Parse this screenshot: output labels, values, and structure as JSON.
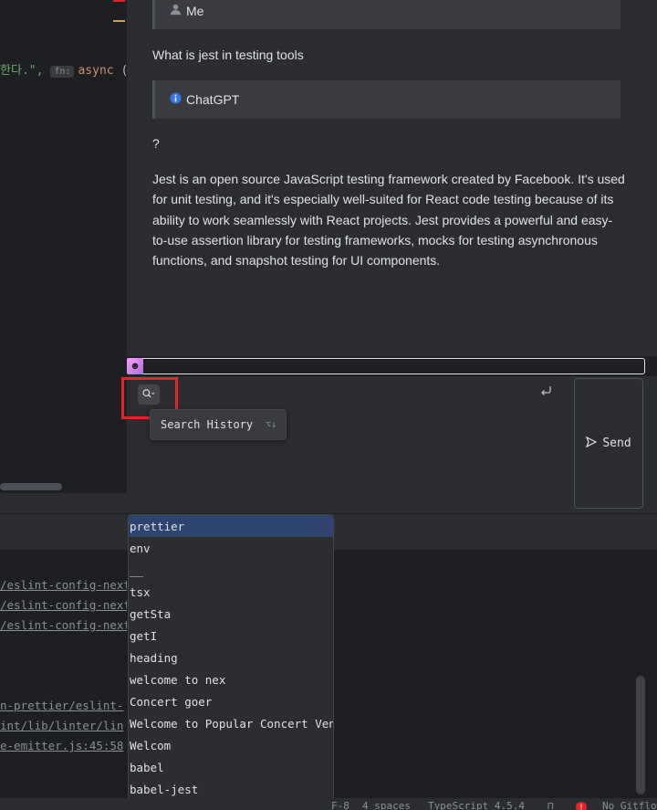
{
  "editor": {
    "code_string": "한다.\",",
    "fn_tag": "fn:",
    "keyword": "async",
    "paren": "("
  },
  "chat": {
    "messages": [
      {
        "role_icon": "person-icon",
        "role_label": "Me"
      },
      {
        "text": "What is jest in testing tools"
      },
      {
        "role_icon": "info-icon",
        "role_label": "ChatGPT"
      },
      {
        "text": "?"
      },
      {
        "text": "Jest is an open source JavaScript testing framework created by Facebook. It's used for unit testing, and it's especially well-suited for React code testing because of its ability to work seamlessly with React projects. Jest provides a powerful and easy-to-use assertion library for testing frameworks, mocks for testing asynchronous functions, and snapshot testing for UI components."
      }
    ]
  },
  "input": {
    "search_tooltip": "Search History",
    "search_shortcut": "⌥↓",
    "send_label": "Send"
  },
  "terminal": {
    "lines": [
      "/eslint-config-next",
      "/eslint-config-next",
      "/eslint-config-next",
      "n-prettier/eslint-",
      "int/lib/linter/lin",
      "e-emitter.js:45:58"
    ]
  },
  "history_dropdown": {
    "items": [
      "prettier",
      "env",
      "__",
      "tsx",
      "getSta",
      "getI",
      "heading",
      "welcome to nex",
      "Concert goer",
      "Welcome to Popular Concert Venues",
      "Welcom",
      "babel",
      "babel-jest"
    ],
    "selected_index": 0
  },
  "statusbar": {
    "encoding": "F-8",
    "indent": "4 spaces",
    "language": "TypeScript 4.5.4",
    "error_count": "!",
    "vcs": "No Gitflow"
  },
  "colors": {
    "accent": "#3574f0",
    "highlight_box": "#e5242a",
    "selection": "#2e436e"
  }
}
